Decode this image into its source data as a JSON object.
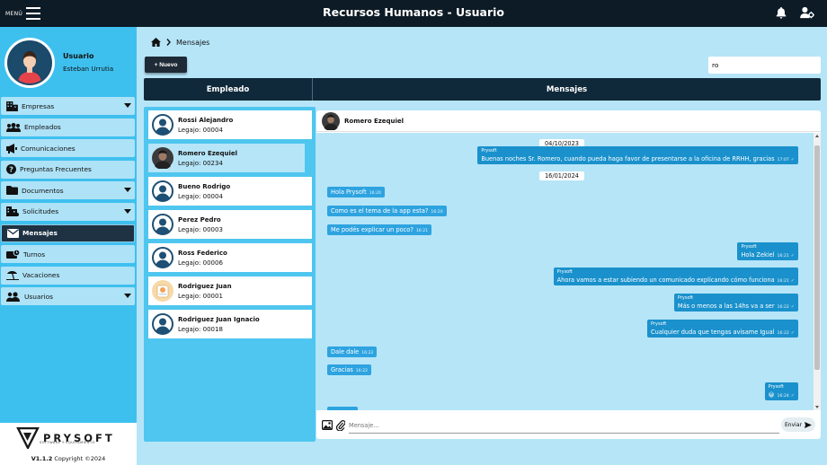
{
  "header": {
    "menu_label": "MENÚ",
    "title": "Recursos Humanos - Usuario"
  },
  "user": {
    "role": "Usuario",
    "name": "Esteban Urrutia"
  },
  "sidebar": {
    "items": [
      {
        "label": "Empresas",
        "icon": "building-icon",
        "dropdown": true
      },
      {
        "label": "Empleados",
        "icon": "people-icon",
        "dropdown": false
      },
      {
        "label": "Comunicaciones",
        "icon": "megaphone-icon",
        "dropdown": false
      },
      {
        "label": "Preguntas Frecuentes",
        "icon": "question-icon",
        "dropdown": false
      },
      {
        "label": "Documentos",
        "icon": "folder-icon",
        "dropdown": true
      },
      {
        "label": "Solicitudes",
        "icon": "requests-icon",
        "dropdown": true
      },
      {
        "label": "Mensajes",
        "icon": "envelope-icon",
        "dropdown": false,
        "active": true
      },
      {
        "label": "Turnos",
        "icon": "shifts-icon",
        "dropdown": false
      },
      {
        "label": "Vacaciones",
        "icon": "beach-icon",
        "dropdown": false
      },
      {
        "label": "Usuarios",
        "icon": "users-icon",
        "dropdown": true
      }
    ]
  },
  "footer": {
    "brand": "PRYSOFT",
    "tagline": "SOFTWARE Y EQUIPAMIENTO",
    "version": "V1.1.2",
    "copyright": " Copyright ©2024"
  },
  "breadcrumb": {
    "current": "Mensajes"
  },
  "toolbar": {
    "new_label": "+ Nuevo",
    "search_value": "ro"
  },
  "columns": {
    "employee": "Empleado",
    "messages": "Mensajes"
  },
  "employees": [
    {
      "name": "Rossi Alejandro",
      "legajo": "Legajo: 00004",
      "avatar": "default"
    },
    {
      "name": "Romero Ezequiel",
      "legajo": "Legajo: 00234",
      "avatar": "photo",
      "selected": true
    },
    {
      "name": "Bueno Rodrigo",
      "legajo": "Legajo: 00004",
      "avatar": "default"
    },
    {
      "name": "Perez Pedro",
      "legajo": "Legajo: 00003",
      "avatar": "default"
    },
    {
      "name": "Ross Federico",
      "legajo": "Legajo: 00006",
      "avatar": "default"
    },
    {
      "name": "Rodriguez Juan",
      "legajo": "Legajo: 00001",
      "avatar": "cartoon"
    },
    {
      "name": "Rodriguez Juan Ignacio",
      "legajo": "Legajo: 00018",
      "avatar": "default"
    }
  ],
  "chat": {
    "contact": "Romero Ezequiel",
    "dates": [
      "04/10/2023",
      "16/01/2024"
    ],
    "messages": [
      {
        "dir": "out",
        "sender": "Prysoft",
        "text": "Buenas noches Sr. Romero, cuando pueda haga favor de presentarse a la oficina de RRHH, gracias",
        "time": "17:07"
      },
      {
        "dir": "in",
        "text": "Hola Prysoft",
        "time": "16:20"
      },
      {
        "dir": "in",
        "text": "Como es el tema de la app esta?",
        "time": "16:20"
      },
      {
        "dir": "in",
        "text": "Me podés explicar un poco?",
        "time": "16:21"
      },
      {
        "dir": "out",
        "sender": "Prysoft",
        "text": "Hola Zekiel",
        "time": "16:21"
      },
      {
        "dir": "out",
        "sender": "Prysoft",
        "text": "Ahora vamos a estar subiendo un comunicado explicando cómo funciona",
        "time": "16:21"
      },
      {
        "dir": "out",
        "sender": "Prysoft",
        "text": "Más o menos a las 14hs va a ser",
        "time": "16:22"
      },
      {
        "dir": "out",
        "sender": "Prysoft",
        "text": "Cualquier duda que tengas avisame Igual",
        "time": "16:22"
      },
      {
        "dir": "in",
        "text": "Dale dale",
        "time": "16:22"
      },
      {
        "dir": "in",
        "text": "Gracias",
        "time": "16:22"
      },
      {
        "dir": "out",
        "sender": "Prysoft",
        "text": "😀",
        "time": "16:24"
      }
    ],
    "input_placeholder": "Mensaje...",
    "send_label": "Enviar"
  },
  "colors": {
    "topbar": "#0d1b26",
    "sidebar": "#3ec0ef",
    "main_bg": "#b6e5f8",
    "bubble_in": "#2da3e0",
    "bubble_out": "#1a91cc"
  }
}
